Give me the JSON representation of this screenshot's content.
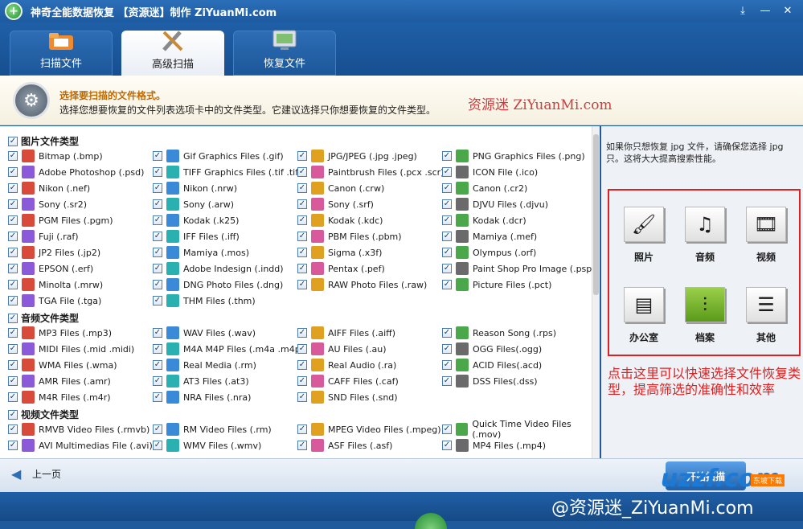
{
  "window": {
    "title": "神奇全能数据恢复 【资源迷】制作 ZiYuanMi.com",
    "buttons": [
      "⤓",
      "—",
      "✕"
    ]
  },
  "tabs": [
    {
      "label": "扫描文件",
      "icon": "folder-icon",
      "state": "inactive"
    },
    {
      "label": "高级扫描",
      "icon": "tools-icon",
      "state": "active"
    },
    {
      "label": "恢复文件",
      "icon": "monitor-icon",
      "state": "inactive"
    }
  ],
  "header": {
    "title": "选择要扫描的文件格式。",
    "desc": "选择您想要恢复的文件列表选项卡中的文件类型。它建议选择只你想要恢复的文件类型。",
    "watermark": "资源迷 ZiYuanMi.com"
  },
  "sections": [
    {
      "label": "图片文件类型"
    },
    {
      "label": "音频文件类型"
    },
    {
      "label": "视频文件类型"
    }
  ],
  "image_items": [
    [
      "Bitmap (.bmp)",
      "Gif Graphics Files (.gif)",
      "JPG/JPEG (.jpg .jpeg)",
      "PNG Graphics Files (.png)"
    ],
    [
      "Adobe Photoshop (.psd)",
      "TIFF Graphics Files (.tif .tiff)",
      "Paintbrush Files (.pcx .scr)",
      "ICON File (.ico)"
    ],
    [
      "Nikon (.nef)",
      "Nikon (.nrw)",
      "Canon (.crw)",
      "Canon (.cr2)"
    ],
    [
      "Sony (.sr2)",
      "Sony (.arw)",
      "Sony (.srf)",
      "DJVU Files (.djvu)"
    ],
    [
      "PGM Files (.pgm)",
      "Kodak (.k25)",
      "Kodak (.kdc)",
      "Kodak (.dcr)"
    ],
    [
      "Fuji (.raf)",
      "IFF Files (.iff)",
      "PBM Files (.pbm)",
      "Mamiya (.mef)"
    ],
    [
      "JP2 Files (.jp2)",
      "Mamiya (.mos)",
      "Sigma (.x3f)",
      "Olympus (.orf)"
    ],
    [
      "EPSON (.erf)",
      "Adobe Indesign (.indd)",
      "Pentax (.pef)",
      "Paint Shop Pro Image (.psp)"
    ],
    [
      "Minolta (.mrw)",
      "DNG Photo Files (.dng)",
      "RAW Photo Files (.raw)",
      "Picture Files (.pct)"
    ],
    [
      "TGA File (.tga)",
      "THM Files (.thm)",
      "",
      ""
    ]
  ],
  "audio_items": [
    [
      "MP3 Files (.mp3)",
      "WAV Files (.wav)",
      "AIFF Files (.aiff)",
      "Reason Song (.rps)"
    ],
    [
      "MIDI Files (.mid .midi)",
      "M4A M4P Files (.m4a .m4p)",
      "AU Files (.au)",
      "OGG Files(.ogg)"
    ],
    [
      "WMA Files (.wma)",
      "Real Media (.rm)",
      "Real Audio (.ra)",
      "ACID Files(.acd)"
    ],
    [
      "AMR Files (.amr)",
      "AT3 Files (.at3)",
      "CAFF Files (.caf)",
      "DSS Files(.dss)"
    ],
    [
      "M4R Files (.m4r)",
      "NRA Files (.nra)",
      "SND Files (.snd)",
      ""
    ]
  ],
  "video_items": [
    [
      "RMVB Video Files (.rmvb)",
      "RM Video Files (.rm)",
      "MPEG Video Files (.mpeg)",
      "Quick Time Video Files (.mov)"
    ],
    [
      "AVI Multimedias File (.avi)",
      "WMV Files (.wmv)",
      "ASF Files (.asf)",
      "MP4 Files (.mp4)"
    ]
  ],
  "right_panel": {
    "tip": "如果你只想恢复 jpg 文件，请确保您选择 jpg 只。这将大大提高搜索性能。",
    "quick": [
      {
        "label": "照片",
        "icon": "photo-icon"
      },
      {
        "label": "音频",
        "icon": "audio-icon"
      },
      {
        "label": "视频",
        "icon": "video-icon"
      },
      {
        "label": "办公室",
        "icon": "office-icon"
      },
      {
        "label": "档案",
        "icon": "archive-icon"
      },
      {
        "label": "其他",
        "icon": "other-icon"
      }
    ],
    "note": "点击这里可以快速选择文件恢复类型，提高筛选的准确性和效率"
  },
  "footer": {
    "back_label": "上一页",
    "start_label": "开始扫描",
    "watermark": "@资源迷_ZiYuanMi.com",
    "site": "uzzf.com",
    "site_tag": "东坡下载"
  },
  "colors": {
    "accent": "#1f5fa7",
    "annotation": "#e02020",
    "title_orange": "#c06a00"
  }
}
